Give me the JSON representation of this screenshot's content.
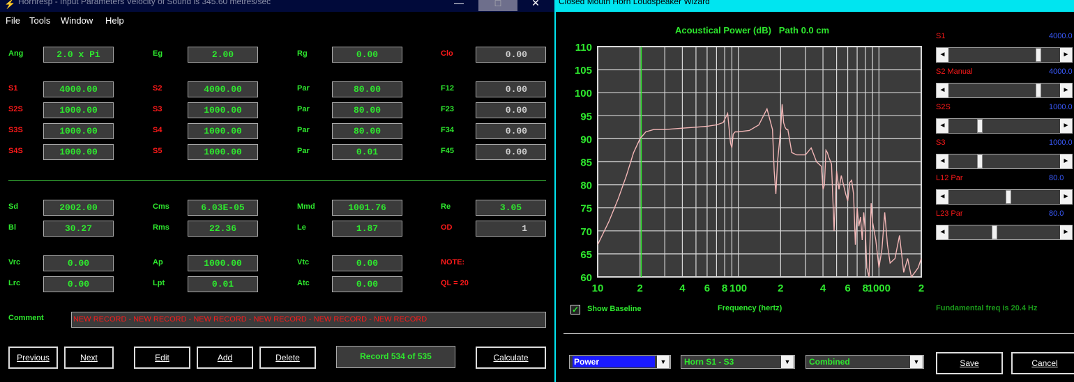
{
  "left": {
    "title": "Hornresp - Input Parameters   Velocity of Sound is 345.60 metres/sec",
    "menu": [
      "File",
      "Tools",
      "Window",
      "Help"
    ],
    "window_controls": [
      "—",
      "□",
      "✕"
    ],
    "fields": [
      {
        "label": "Ang",
        "label_color": "g",
        "value": "2.0 x Pi",
        "value_color": "g"
      },
      {
        "label": "Eg",
        "label_color": "g",
        "value": "2.00",
        "value_color": "g"
      },
      {
        "label": "Rg",
        "label_color": "g",
        "value": "0.00",
        "value_color": "g"
      },
      {
        "label": "Clo",
        "label_color": "r",
        "value": "0.00",
        "value_color": "grey"
      },
      {
        "label": "S1",
        "label_color": "r",
        "value": "4000.00",
        "value_color": "g"
      },
      {
        "label": "S2",
        "label_color": "r",
        "value": "4000.00",
        "value_color": "g"
      },
      {
        "label": "Par",
        "label_color": "g",
        "value": "80.00",
        "value_color": "g"
      },
      {
        "label": "F12",
        "label_color": "g",
        "value": "0.00",
        "value_color": "grey"
      },
      {
        "label": "S2S",
        "label_color": "r",
        "value": "1000.00",
        "value_color": "g"
      },
      {
        "label": "S3",
        "label_color": "r",
        "value": "1000.00",
        "value_color": "g"
      },
      {
        "label": "Par",
        "label_color": "g",
        "value": "80.00",
        "value_color": "g"
      },
      {
        "label": "F23",
        "label_color": "g",
        "value": "0.00",
        "value_color": "grey"
      },
      {
        "label": "S3S",
        "label_color": "r",
        "value": "1000.00",
        "value_color": "g"
      },
      {
        "label": "S4",
        "label_color": "r",
        "value": "1000.00",
        "value_color": "g"
      },
      {
        "label": "Par",
        "label_color": "g",
        "value": "80.00",
        "value_color": "g"
      },
      {
        "label": "F34",
        "label_color": "g",
        "value": "0.00",
        "value_color": "grey"
      },
      {
        "label": "S4S",
        "label_color": "r",
        "value": "1000.00",
        "value_color": "g"
      },
      {
        "label": "S5",
        "label_color": "r",
        "value": "1000.00",
        "value_color": "g"
      },
      {
        "label": "Par",
        "label_color": "g",
        "value": "0.01",
        "value_color": "g"
      },
      {
        "label": "F45",
        "label_color": "g",
        "value": "0.00",
        "value_color": "grey"
      },
      {
        "label": "Sd",
        "label_color": "g",
        "value": "2002.00",
        "value_color": "g"
      },
      {
        "label": "Cms",
        "label_color": "g",
        "value": "6.03E-05",
        "value_color": "g"
      },
      {
        "label": "Mmd",
        "label_color": "g",
        "value": "1001.76",
        "value_color": "g"
      },
      {
        "label": "Re",
        "label_color": "g",
        "value": "3.05",
        "value_color": "g"
      },
      {
        "label": "Bl",
        "label_color": "g",
        "value": "30.27",
        "value_color": "g"
      },
      {
        "label": "Rms",
        "label_color": "g",
        "value": "22.36",
        "value_color": "g"
      },
      {
        "label": "Le",
        "label_color": "g",
        "value": "1.87",
        "value_color": "g"
      },
      {
        "label": "OD",
        "label_color": "r",
        "value": "1",
        "value_color": "grey"
      },
      {
        "label": "Vrc",
        "label_color": "g",
        "value": "0.00",
        "value_color": "g"
      },
      {
        "label": "Ap",
        "label_color": "g",
        "value": "1000.00",
        "value_color": "g"
      },
      {
        "label": "Vtc",
        "label_color": "g",
        "value": "0.00",
        "value_color": "g"
      },
      {
        "label": "Lrc",
        "label_color": "g",
        "value": "0.00",
        "value_color": "g"
      },
      {
        "label": "Lpt",
        "label_color": "g",
        "value": "0.01",
        "value_color": "g"
      },
      {
        "label": "Atc",
        "label_color": "g",
        "value": "0.00",
        "value_color": "g"
      }
    ],
    "note_label": "NOTE:",
    "ql_label": "QL = 20",
    "comment_label": "Comment",
    "comment_value": "NEW RECORD - NEW RECORD - NEW RECORD - NEW RECORD - NEW RECORD - NEW RECORD",
    "buttons": {
      "previous": "Previous",
      "next": "Next",
      "edit": "Edit",
      "add": "Add",
      "delete": "Delete",
      "calculate": "Calculate"
    },
    "record_status": "Record 534 of 535"
  },
  "right": {
    "title": "Closed Mouth Horn Loudspeaker Wizard",
    "chart_title": "Acoustical Power (dB)   Path 0.0 cm",
    "x_axis_label": "Frequency (hertz)",
    "show_baseline_label": "Show Baseline",
    "show_baseline_checked": true,
    "fundamental_text": "Fundamental freq is 20.4 Hz",
    "sliders": [
      {
        "name": "S1",
        "label": "S1",
        "label_color": "#ff1a1a",
        "value": "4000.0",
        "fraction": 0.82
      },
      {
        "name": "S2",
        "label": "S2  Manual",
        "label_color": "#ff1a1a",
        "value": "4000.0",
        "fraction": 0.82
      },
      {
        "name": "S2S",
        "label": "S2S",
        "label_color": "#ff1a1a",
        "value": "1000.0",
        "fraction": 0.27
      },
      {
        "name": "S3",
        "label": "S3",
        "label_color": "#ff1a1a",
        "value": "1000.0",
        "fraction": 0.27
      },
      {
        "name": "L12",
        "label": "L12  Par",
        "label_color": "#ff1a1a",
        "value": "80.0",
        "fraction": 0.54
      },
      {
        "name": "L23",
        "label": "L23  Par",
        "label_color": "#ff1a1a",
        "value": "80.0",
        "fraction": 0.41
      }
    ],
    "combos": {
      "mode": "Power",
      "horn": "Horn S1 - S3",
      "combine": "Combined"
    },
    "buttons": {
      "save": "Save",
      "cancel": "Cancel"
    }
  },
  "chart_data": {
    "type": "line",
    "title": "Acoustical Power (dB)   Path 0.0 cm",
    "xlabel": "Frequency (hertz)",
    "ylabel": "",
    "x_scale": "log",
    "xlim": [
      10,
      2000
    ],
    "ylim": [
      60,
      110
    ],
    "x_tick_labels": [
      "10",
      "2",
      "4",
      "6",
      "8",
      "100",
      "2",
      "4",
      "6",
      "8",
      "1000",
      "2"
    ],
    "x_tick_values": [
      10,
      20,
      40,
      60,
      80,
      100,
      200,
      400,
      600,
      800,
      1000,
      2000
    ],
    "y_ticks": [
      60,
      65,
      70,
      75,
      80,
      85,
      90,
      95,
      100,
      105,
      110
    ],
    "grid": true,
    "baseline_x": 20.4,
    "colors": {
      "line": "#f2b6b6",
      "grid": "#d9d9d9",
      "baseline": "#2ee82e",
      "plot_bg": "#3b3b3b"
    },
    "series": [
      {
        "x": [
          10,
          12,
          14,
          16,
          18,
          20,
          22,
          25,
          30,
          40,
          50,
          60,
          70,
          78,
          84,
          88,
          90,
          92,
          95,
          100,
          120,
          140,
          160,
          175,
          180,
          185,
          190,
          200,
          205,
          210,
          215,
          220,
          225,
          240,
          260,
          300,
          330,
          360,
          390,
          400,
          410,
          420,
          430,
          440,
          460,
          480,
          500,
          520,
          540,
          560,
          580,
          600,
          620,
          640,
          660,
          680,
          700,
          720,
          740,
          760,
          780,
          800,
          820,
          850,
          880,
          900,
          950,
          1000,
          1050,
          1100,
          1150,
          1200,
          1300,
          1400,
          1500,
          1600,
          1700,
          1800,
          1900,
          2000
        ],
        "y": [
          67,
          72,
          77,
          82,
          87,
          90,
          91.5,
          92,
          92,
          92.3,
          92.5,
          92.7,
          93,
          93.5,
          95.5,
          89,
          88,
          91,
          91.5,
          91.5,
          91.8,
          93,
          96.5,
          92,
          83,
          78,
          85,
          92,
          97.5,
          93.5,
          92.5,
          92,
          92,
          87,
          86.5,
          86.5,
          88,
          85,
          84,
          79,
          80,
          87.5,
          87,
          86,
          84.5,
          70,
          83,
          79,
          82,
          80,
          78,
          76.5,
          80.5,
          81,
          78,
          67,
          75,
          71,
          73,
          68,
          74,
          70,
          62,
          60,
          76,
          72,
          68,
          62,
          66,
          74,
          67,
          63,
          64,
          69,
          61,
          64,
          60,
          61,
          62,
          64
        ]
      }
    ]
  }
}
